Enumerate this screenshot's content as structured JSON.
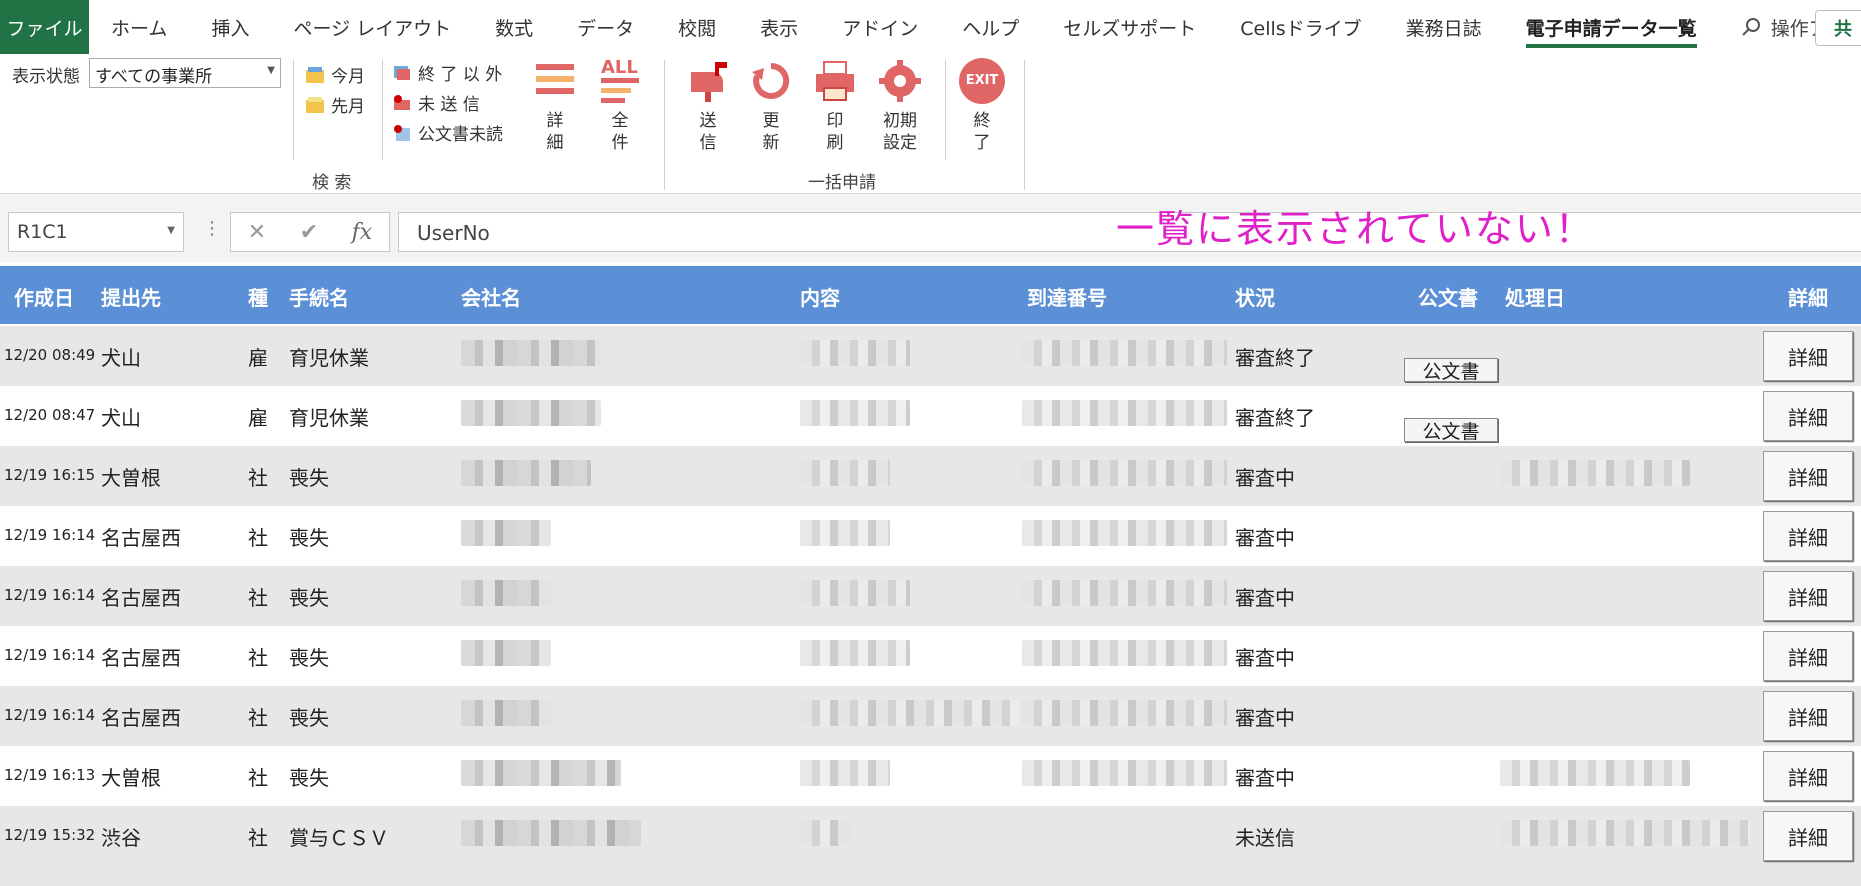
{
  "ribbon_tabs": [
    "ファイル",
    "ホーム",
    "挿入",
    "ページ レイアウト",
    "数式",
    "データ",
    "校閲",
    "表示",
    "アドイン",
    "ヘルプ",
    "セルズサポート",
    "Cellsドライブ",
    "業務日誌",
    "電子申請データ一覧"
  ],
  "assist_label": "操作アシスト",
  "share_label": "共",
  "ribbon": {
    "state_label": "表示状態",
    "state_value": "すべての事業所",
    "this_month": "今月",
    "last_month": "先月",
    "not_finished": "終 了 以 外",
    "unsent": "未 送 信",
    "doc_unread": "公文書未読",
    "detail": "詳\n細",
    "all": "全\n件",
    "search_group": "検 索",
    "send": "送\n信",
    "refresh": "更\n新",
    "print": "印\n刷",
    "initial_settings": "初期\n設定",
    "exit_btn": "終\n了",
    "bulk_group": "一括申請",
    "all_icon_text": "ALL",
    "exit_icon_text": "EXIT"
  },
  "formula_bar": {
    "name_box": "R1C1",
    "fx": "fx",
    "formula": "UserNo",
    "cancel": "✕",
    "enter": "✔"
  },
  "annotation": "一覧に表示されていない！",
  "table": {
    "headers": {
      "created": "作成日",
      "dest": "提出先",
      "kind": "種",
      "procedure": "手続名",
      "company": "会社名",
      "content": "内容",
      "arrival": "到達番号",
      "status": "状況",
      "doc": "公文書",
      "processed": "処理日",
      "detail": "詳細"
    },
    "doc_button": "公文書",
    "detail_button": "詳細",
    "rows": [
      {
        "date": "12/20 08:49",
        "dest": "犬山",
        "kind": "雇",
        "proc": "育児休業",
        "status": "審査終了",
        "doc": true,
        "processed": false
      },
      {
        "date": "12/20 08:47",
        "dest": "犬山",
        "kind": "雇",
        "proc": "育児休業",
        "status": "審査終了",
        "doc": true,
        "processed": false
      },
      {
        "date": "12/19 16:15",
        "dest": "大曽根",
        "kind": "社",
        "proc": "喪失",
        "status": "審査中",
        "doc": false,
        "processed": true
      },
      {
        "date": "12/19 16:14",
        "dest": "名古屋西",
        "kind": "社",
        "proc": "喪失",
        "status": "審査中",
        "doc": false,
        "processed": false
      },
      {
        "date": "12/19 16:14",
        "dest": "名古屋西",
        "kind": "社",
        "proc": "喪失",
        "status": "審査中",
        "doc": false,
        "processed": false
      },
      {
        "date": "12/19 16:14",
        "dest": "名古屋西",
        "kind": "社",
        "proc": "喪失",
        "status": "審査中",
        "doc": false,
        "processed": false
      },
      {
        "date": "12/19 16:14",
        "dest": "名古屋西",
        "kind": "社",
        "proc": "喪失",
        "status": "審査中",
        "doc": false,
        "processed": false
      },
      {
        "date": "12/19 16:13",
        "dest": "大曽根",
        "kind": "社",
        "proc": "喪失",
        "status": "審査中",
        "doc": false,
        "processed": true
      },
      {
        "date": "12/19 15:32",
        "dest": "渋谷",
        "kind": "社",
        "proc": "賞与ＣＳＶ",
        "status": "未送信",
        "doc": false,
        "processed": true
      }
    ]
  },
  "colors": {
    "file_tab": "#217346",
    "header_bg": "#5b8fd6",
    "annotation": "#e020c8"
  }
}
